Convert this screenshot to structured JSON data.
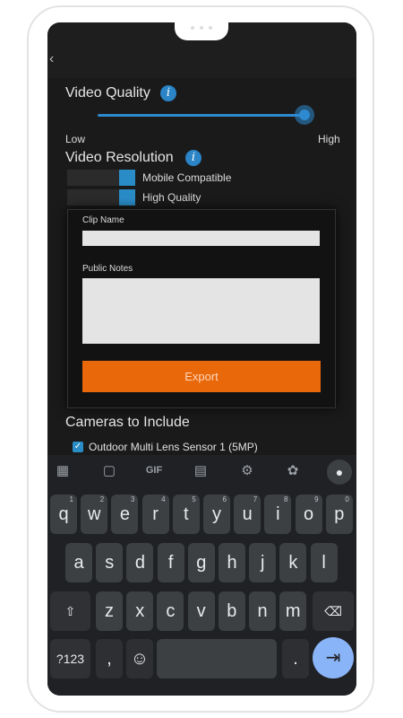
{
  "app": {
    "back_glyph": "‹",
    "video_quality": {
      "label": "Video Quality",
      "low": "Low",
      "high": "High",
      "level": 1.0
    },
    "video_resolution": {
      "label": "Video Resolution",
      "options": [
        "Mobile Compatible",
        "High Quality"
      ]
    },
    "cameras_label": "Cameras to Include",
    "cameras": [
      {
        "label": "Outdoor Multi Lens Sensor 1 (5MP)",
        "checked": true
      }
    ],
    "accent_color": "#2a8cc7"
  },
  "dialog": {
    "clip_name_label": "Clip Name",
    "clip_name_value": "",
    "public_notes_label": "Public Notes",
    "public_notes_value": "",
    "export_label": "Export",
    "export_color": "#e8680a"
  },
  "keyboard": {
    "toolbar_icons": [
      "apps-icon",
      "sticker-icon",
      "gif-icon",
      "clipboard-icon",
      "settings-icon",
      "palette-icon",
      "mic-icon"
    ],
    "gif_label": "GIF",
    "row1": [
      "q",
      "w",
      "e",
      "r",
      "t",
      "y",
      "u",
      "i",
      "o",
      "p"
    ],
    "row1_hints": [
      "1",
      "2",
      "3",
      "4",
      "5",
      "6",
      "7",
      "8",
      "9",
      "0"
    ],
    "row2": [
      "a",
      "s",
      "d",
      "f",
      "g",
      "h",
      "j",
      "k",
      "l"
    ],
    "row3": [
      "z",
      "x",
      "c",
      "v",
      "b",
      "n",
      "m"
    ],
    "symbols_label": "?123",
    "comma": ",",
    "period": ".",
    "shift_glyph": "⇧",
    "backspace_glyph": "⌫",
    "emoji_glyph": "☺",
    "enter_glyph": "⇥"
  }
}
